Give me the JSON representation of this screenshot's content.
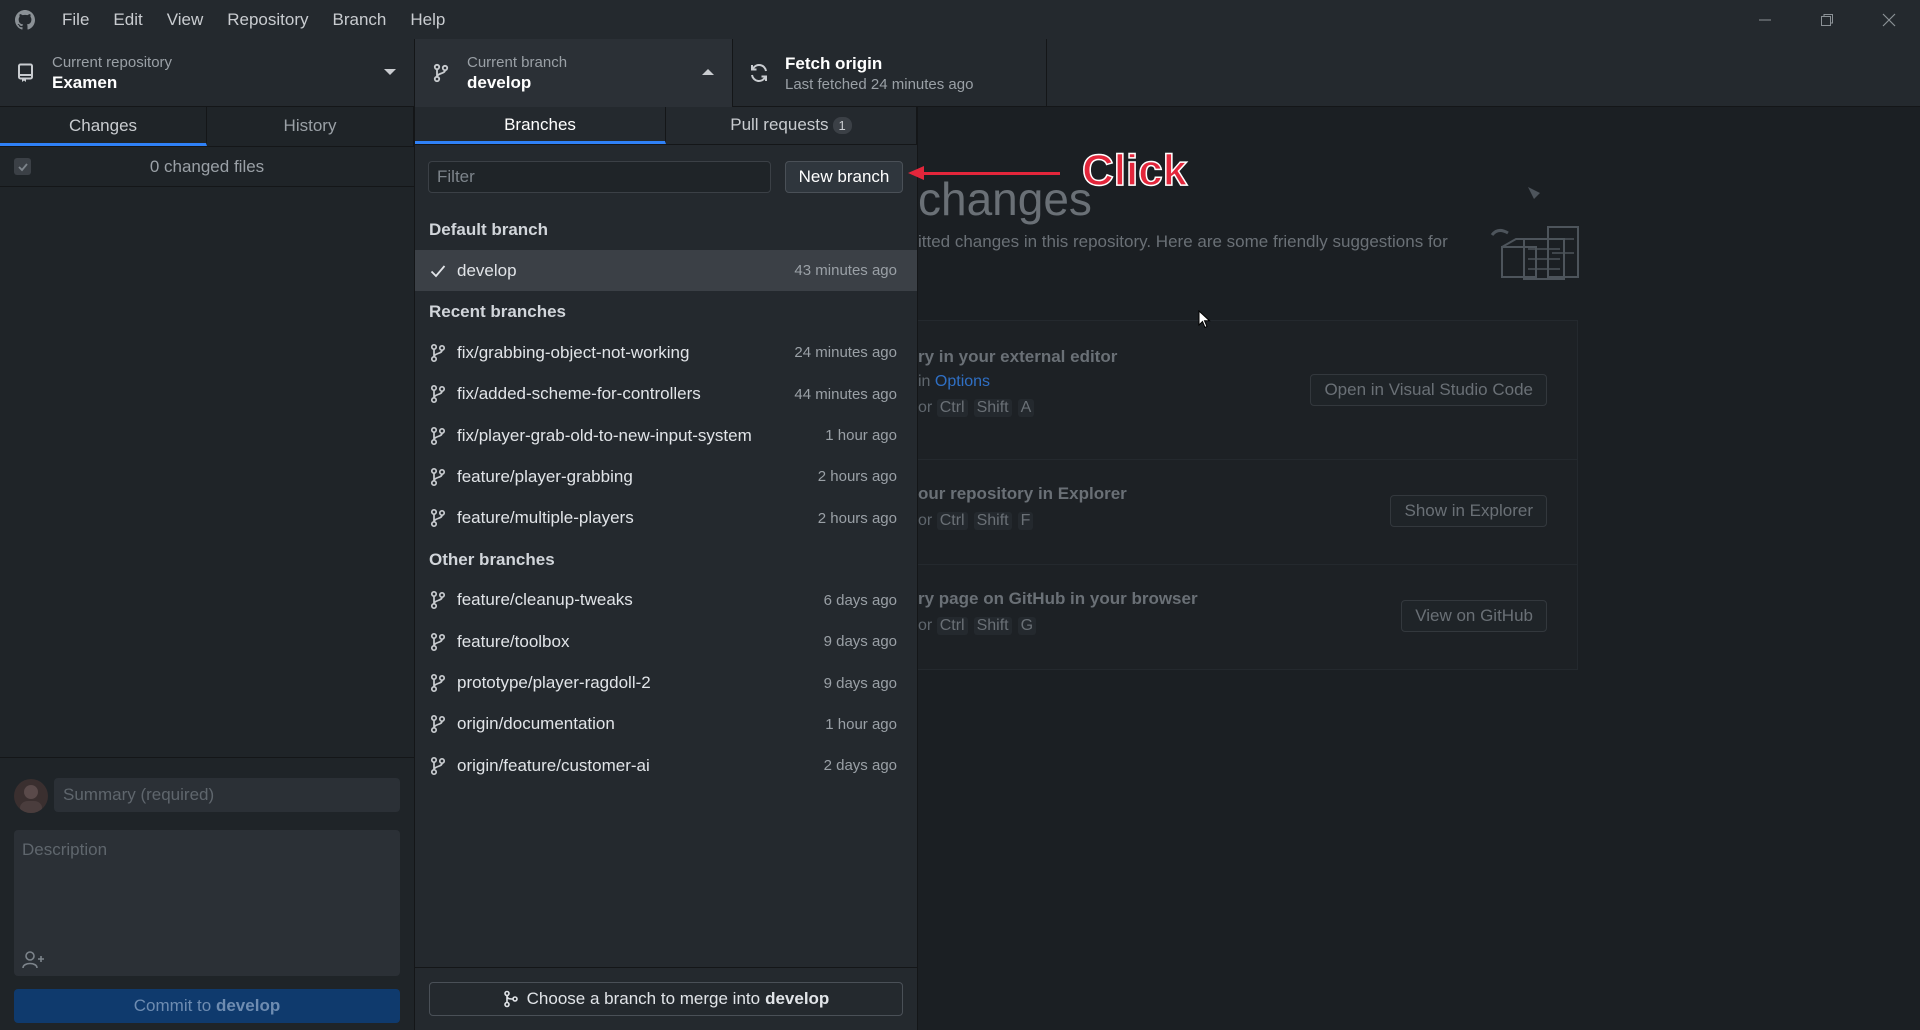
{
  "menu": {
    "items": [
      "File",
      "Edit",
      "View",
      "Repository",
      "Branch",
      "Help"
    ]
  },
  "toolbar": {
    "repo_label": "Current repository",
    "repo_name": "Examen",
    "branch_label": "Current branch",
    "branch_name": "develop",
    "fetch_title": "Fetch origin",
    "fetch_sub": "Last fetched 24 minutes ago"
  },
  "sidebar": {
    "tabs": [
      "Changes",
      "History"
    ],
    "changed_files": "0 changed files",
    "summary_placeholder": "Summary (required)",
    "description_placeholder": "Description",
    "commit_prefix": "Commit to",
    "commit_branch": "develop"
  },
  "branch_panel": {
    "tab_branches": "Branches",
    "tab_pull_requests": "Pull requests",
    "pr_count": "1",
    "filter_placeholder": "Filter",
    "new_branch_label": "New branch",
    "default_header": "Default branch",
    "default_branch": {
      "name": "develop",
      "time": "43 minutes ago"
    },
    "recent_header": "Recent branches",
    "recent": [
      {
        "name": "fix/grabbing-object-not-working",
        "time": "24 minutes ago"
      },
      {
        "name": "fix/added-scheme-for-controllers",
        "time": "44 minutes ago"
      },
      {
        "name": "fix/player-grab-old-to-new-input-system",
        "time": "1 hour ago"
      },
      {
        "name": "feature/player-grabbing",
        "time": "2 hours ago"
      },
      {
        "name": "feature/multiple-players",
        "time": "2 hours ago"
      }
    ],
    "other_header": "Other branches",
    "other": [
      {
        "name": "feature/cleanup-tweaks",
        "time": "6 days ago"
      },
      {
        "name": "feature/toolbox",
        "time": "9 days ago"
      },
      {
        "name": "prototype/player-ragdoll-2",
        "time": "9 days ago"
      },
      {
        "name": "origin/documentation",
        "time": "1 hour ago"
      },
      {
        "name": "origin/feature/customer-ai",
        "time": "2 days ago"
      }
    ],
    "merge_prefix": "Choose a branch to merge into",
    "merge_branch": "develop"
  },
  "main": {
    "title": "changes",
    "subtitle": "itted changes in this repository. Here are some friendly suggestions for",
    "editor_title": "ry in your external editor",
    "editor_line_prefix": "in",
    "editor_line_link": "Options",
    "editor_keys": [
      "or",
      "Ctrl",
      "Shift",
      "A"
    ],
    "editor_button": "Open in Visual Studio Code",
    "explorer_title": "our repository in Explorer",
    "explorer_keys": [
      "or",
      "Ctrl",
      "Shift",
      "F"
    ],
    "explorer_button": "Show in Explorer",
    "github_title": "ry page on GitHub in your browser",
    "github_keys": [
      "or",
      "Ctrl",
      "Shift",
      "G"
    ],
    "github_button": "View on GitHub"
  },
  "annotation": {
    "text": "Click",
    "color": "#e3263b"
  },
  "colors": {
    "accent": "#2f81f7",
    "background": "#24292e",
    "sidebar": "#1f2428"
  }
}
